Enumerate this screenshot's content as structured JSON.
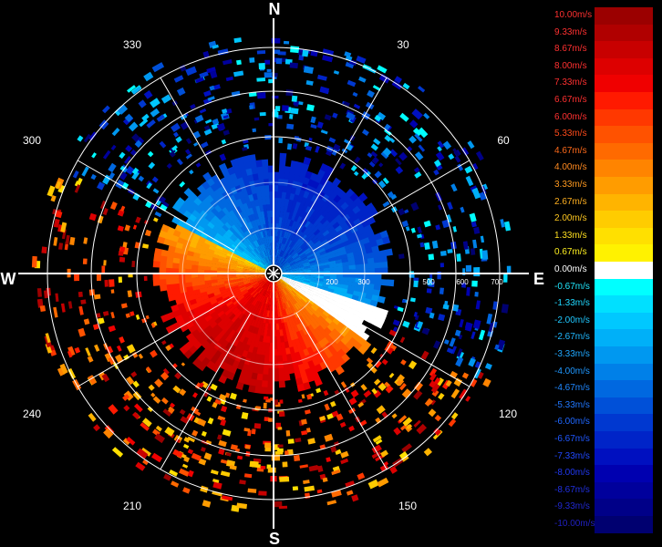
{
  "radar": {
    "cardinals": {
      "n": "N",
      "e": "E",
      "s": "S",
      "w": "W"
    },
    "bearings": [
      "30",
      "60",
      "120",
      "150",
      "210",
      "240",
      "300",
      "330"
    ],
    "range_labels": [
      "200",
      "300",
      "500",
      "600",
      "700"
    ]
  },
  "legend": {
    "entries": [
      {
        "label": "10.00m/s",
        "color": "#9b0000",
        "text_color": "#ff3030"
      },
      {
        "label": "9.33m/s",
        "color": "#b00000",
        "text_color": "#ff3030"
      },
      {
        "label": "8.67m/s",
        "color": "#c80000",
        "text_color": "#ff3030"
      },
      {
        "label": "8.00m/s",
        "color": "#dd0000",
        "text_color": "#ff3030"
      },
      {
        "label": "7.33m/s",
        "color": "#f00000",
        "text_color": "#ff3030"
      },
      {
        "label": "6.67m/s",
        "color": "#ff1a00",
        "text_color": "#ff3030"
      },
      {
        "label": "6.00m/s",
        "color": "#ff3800",
        "text_color": "#ff3030"
      },
      {
        "label": "5.33m/s",
        "color": "#ff5200",
        "text_color": "#ff4a1a"
      },
      {
        "label": "4.67m/s",
        "color": "#ff6a00",
        "text_color": "#ff6a1a"
      },
      {
        "label": "4.00m/s",
        "color": "#ff8400",
        "text_color": "#ff8a20"
      },
      {
        "label": "3.33m/s",
        "color": "#ff9c00",
        "text_color": "#ff9a20"
      },
      {
        "label": "2.67m/s",
        "color": "#ffb400",
        "text_color": "#ffb020"
      },
      {
        "label": "2.00m/s",
        "color": "#ffcc00",
        "text_color": "#ffc820"
      },
      {
        "label": "1.33m/s",
        "color": "#ffe000",
        "text_color": "#ffe020"
      },
      {
        "label": "0.67m/s",
        "color": "#fff200",
        "text_color": "#fff020"
      },
      {
        "label": "0.00m/s",
        "color": "#ffffff",
        "text_color": "#ffffff"
      },
      {
        "label": "-0.67m/s",
        "color": "#00ffff",
        "text_color": "#20e8ff"
      },
      {
        "label": "-1.33m/s",
        "color": "#00e0ff",
        "text_color": "#20d8ff"
      },
      {
        "label": "-2.00m/s",
        "color": "#00c8ff",
        "text_color": "#20c8ff"
      },
      {
        "label": "-2.67m/s",
        "color": "#00b0f8",
        "text_color": "#20b8ff"
      },
      {
        "label": "-3.33m/s",
        "color": "#0098f0",
        "text_color": "#20a8ff"
      },
      {
        "label": "-4.00m/s",
        "color": "#0080e8",
        "text_color": "#2098ff"
      },
      {
        "label": "-4.67m/s",
        "color": "#0068e0",
        "text_color": "#2088ff"
      },
      {
        "label": "-5.33m/s",
        "color": "#0050d8",
        "text_color": "#2078ff"
      },
      {
        "label": "-6.00m/s",
        "color": "#0038d0",
        "text_color": "#2068ff"
      },
      {
        "label": "-6.67m/s",
        "color": "#0024c8",
        "text_color": "#2058ff"
      },
      {
        "label": "-7.33m/s",
        "color": "#0010c0",
        "text_color": "#2048ff"
      },
      {
        "label": "-8.00m/s",
        "color": "#0000b0",
        "text_color": "#2038f0"
      },
      {
        "label": "-8.67m/s",
        "color": "#00009c",
        "text_color": "#2030e0"
      },
      {
        "label": "-9.33m/s",
        "color": "#000088",
        "text_color": "#2028d0"
      },
      {
        "label": "-10.00m/s",
        "color": "#000070",
        "text_color": "#2020c0"
      }
    ]
  }
}
